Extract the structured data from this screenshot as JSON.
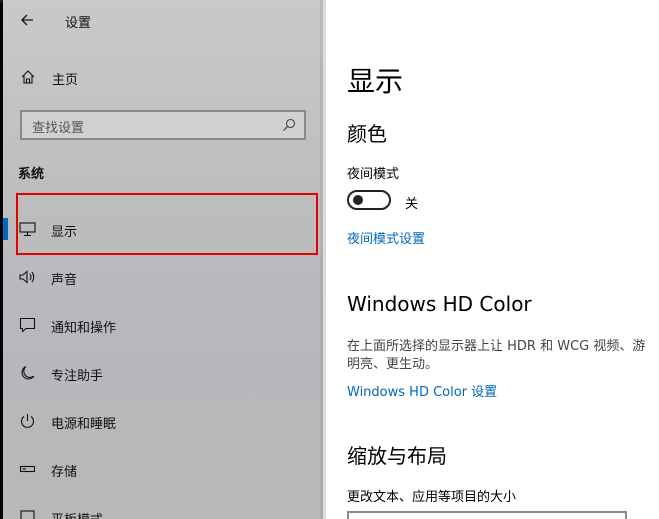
{
  "app": {
    "title": "设置",
    "back_icon": "back-arrow-icon"
  },
  "sidebar": {
    "home_label": "主页",
    "search_placeholder": "查找设置",
    "section_title": "系统",
    "items": [
      {
        "label": "显示",
        "icon": "monitor-icon",
        "active": true
      },
      {
        "label": "声音",
        "icon": "speaker-icon"
      },
      {
        "label": "通知和操作",
        "icon": "notification-icon"
      },
      {
        "label": "专注助手",
        "icon": "moon-icon"
      },
      {
        "label": "电源和睡眠",
        "icon": "power-icon"
      },
      {
        "label": "存储",
        "icon": "storage-icon"
      },
      {
        "label": "平板模式",
        "icon": "tablet-icon"
      }
    ]
  },
  "main": {
    "page_title": "显示",
    "color_heading": "颜色",
    "night_mode_label": "夜间模式",
    "night_mode_state": "关",
    "night_mode_link": "夜间模式设置",
    "hdr_heading": "Windows HD Color",
    "hdr_desc_line1": "在上面所选择的显示器上让 HDR 和 WCG 视频、游",
    "hdr_desc_line2": "明亮、更生动。",
    "hdr_link": "Windows HD Color 设置",
    "scale_heading": "缩放与布局",
    "scale_label": "更改文本、应用等项目的大小"
  },
  "colors": {
    "accent": "#0067c0",
    "highlight": "#e60000"
  }
}
